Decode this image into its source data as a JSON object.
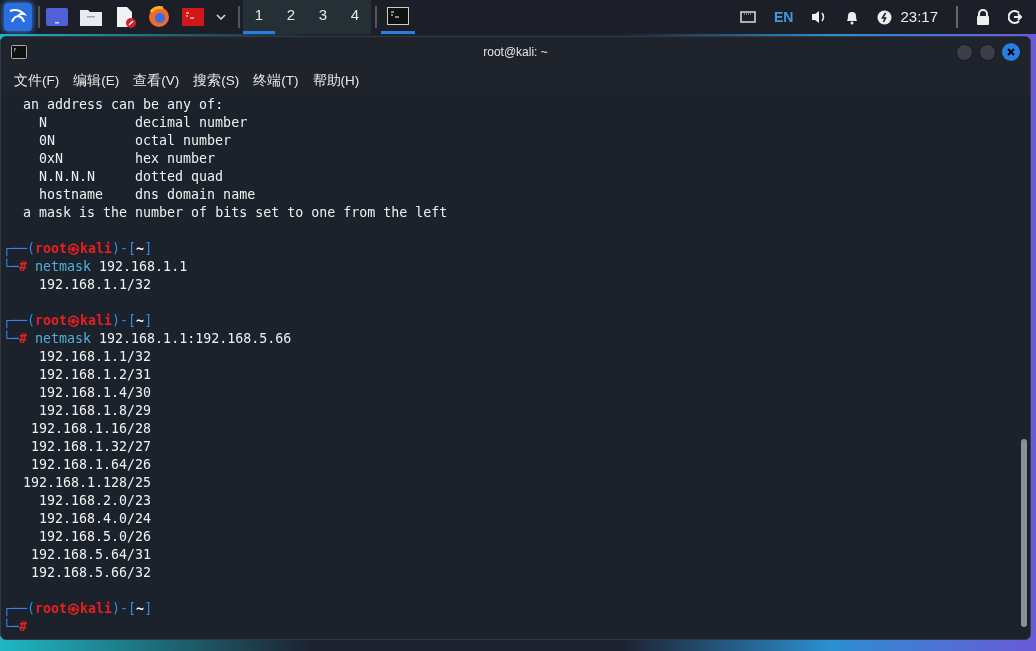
{
  "panel": {
    "launchers": [
      {
        "kind": "desktop"
      },
      {
        "kind": "files"
      },
      {
        "kind": "editor"
      },
      {
        "kind": "browser"
      },
      {
        "kind": "terminal"
      }
    ],
    "workspaces": [
      {
        "label": "1",
        "selected": true
      },
      {
        "label": "2",
        "selected": false
      },
      {
        "label": "3",
        "selected": false
      },
      {
        "label": "4",
        "selected": false
      }
    ],
    "tasks": [
      {
        "kind": "terminal",
        "selected": true
      }
    ],
    "keyboard_layout": "EN",
    "clock": "23:17"
  },
  "window": {
    "title": "root@kali: ~",
    "menu": [
      "文件(F)",
      "编辑(E)",
      "查看(V)",
      "搜索(S)",
      "终端(T)",
      "帮助(H)"
    ]
  },
  "terminal": {
    "lines": [
      {
        "kind": "text",
        "text": "an address can be any of:"
      },
      {
        "kind": "table",
        "term": "N",
        "desc": "decimal number"
      },
      {
        "kind": "table",
        "term": "0N",
        "desc": "octal number"
      },
      {
        "kind": "table",
        "term": "0xN",
        "desc": "hex number"
      },
      {
        "kind": "table",
        "term": "N.N.N.N",
        "desc": "dotted quad"
      },
      {
        "kind": "table",
        "term": "hostname",
        "desc": "dns domain name"
      },
      {
        "kind": "text",
        "text": "a mask is the number of bits set to one from the left"
      },
      {
        "kind": "blank"
      },
      {
        "kind": "prompt",
        "open": "┌──(",
        "user_host": "root㉿kali",
        "mid": ")-[",
        "dir": "~",
        "close": "]"
      },
      {
        "kind": "command",
        "corner": "└─",
        "sign": "#",
        "command": "netmask",
        "args": "192.168.1.1"
      },
      {
        "kind": "output",
        "text": "192.168.1.1/32"
      },
      {
        "kind": "blank"
      },
      {
        "kind": "prompt",
        "open": "┌──(",
        "user_host": "root㉿kali",
        "mid": ")-[",
        "dir": "~",
        "close": "]"
      },
      {
        "kind": "command",
        "corner": "└─",
        "sign": "#",
        "command": "netmask",
        "args": "192.168.1.1:192.168.5.66"
      },
      {
        "kind": "output",
        "text": "192.168.1.1/32"
      },
      {
        "kind": "output",
        "text": "192.168.1.2/31"
      },
      {
        "kind": "output",
        "text": "192.168.1.4/30"
      },
      {
        "kind": "output",
        "text": "192.168.1.8/29"
      },
      {
        "kind": "output",
        "text": "192.168.1.16/28"
      },
      {
        "kind": "output",
        "text": "192.168.1.32/27"
      },
      {
        "kind": "output",
        "text": "192.168.1.64/26"
      },
      {
        "kind": "output",
        "text": "192.168.1.128/25"
      },
      {
        "kind": "output",
        "text": "192.168.2.0/23"
      },
      {
        "kind": "output",
        "text": "192.168.4.0/24"
      },
      {
        "kind": "output",
        "text": "192.168.5.0/26"
      },
      {
        "kind": "output",
        "text": "192.168.5.64/31"
      },
      {
        "kind": "output",
        "text": "192.168.5.66/32"
      },
      {
        "kind": "blank"
      },
      {
        "kind": "prompt",
        "open": "┌──(",
        "user_host": "root㉿kali",
        "mid": ")-[",
        "dir": "~",
        "close": "]"
      },
      {
        "kind": "command",
        "corner": "└─",
        "sign": "#"
      }
    ]
  }
}
